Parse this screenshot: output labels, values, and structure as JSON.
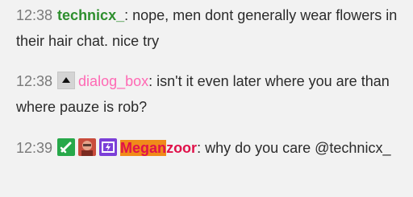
{
  "messages": [
    {
      "timestamp": "12:38",
      "username": "technicx_",
      "username_color": "#2e8f2e",
      "text": ": nope, men dont generally wear flowers in their hair chat. nice try"
    },
    {
      "timestamp": "12:38",
      "badges": [
        "moderator-arrow-icon"
      ],
      "username": "dialog_box",
      "username_color": "#ff69b4",
      "text": ": isn't it even later where you are than where pauze is rob?"
    },
    {
      "timestamp": "12:39",
      "badges": [
        "sword-icon",
        "avatar-icon",
        "bolt-icon"
      ],
      "username_highlight": "Megan",
      "username_rest": "zoor",
      "username_color": "#e0114a",
      "highlight_color": "#f08a1a",
      "text": ": why do you care @technicx_"
    }
  ]
}
